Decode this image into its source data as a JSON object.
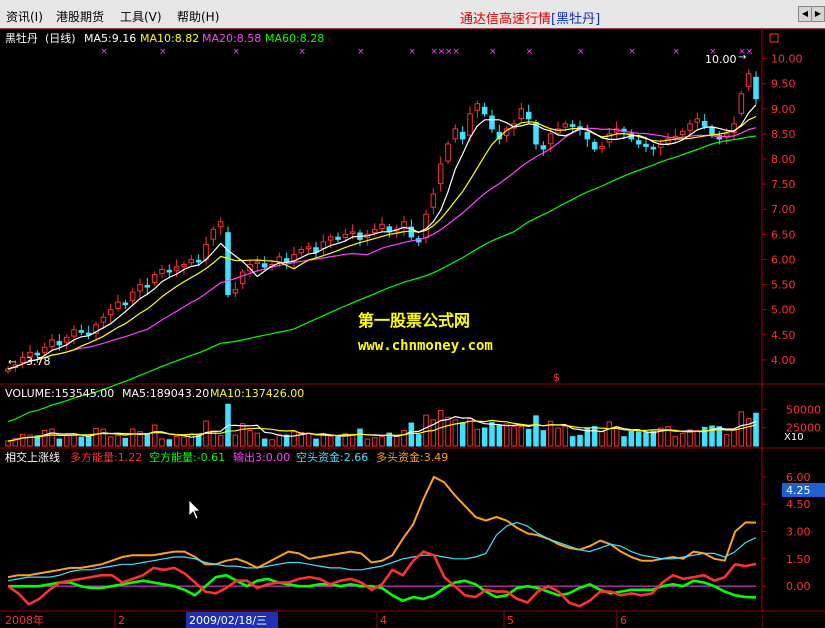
{
  "menubar": {
    "items": [
      "资讯(I)",
      "港股期货",
      "工具(V)",
      "帮助(H)"
    ],
    "title_main": "通达信高速行情",
    "title_stock": "[黑牡丹]"
  },
  "chart_data": [
    {
      "type": "candlestick",
      "panel": "price",
      "stock": "黑牡丹",
      "period": "(日线)",
      "ma_labels": [
        {
          "text": "MA5:9.16",
          "color": "#ffffff"
        },
        {
          "text": "MA10:8.82",
          "color": "#ffff00"
        },
        {
          "text": "MA20:8.58",
          "color": "#ff40ff"
        },
        {
          "text": "MA60:8.28",
          "color": "#00ff00"
        }
      ],
      "ylim": [
        3.6,
        10.25
      ],
      "yticks": [
        "10.00",
        "9.50",
        "9.00",
        "8.50",
        "8.00",
        "7.50",
        "7.00",
        "6.50",
        "6.00",
        "5.50",
        "5.00",
        "4.50",
        "4.00"
      ],
      "annotations": {
        "low_label": "3.78",
        "high_label": "10.00",
        "symbol": "$"
      },
      "close": [
        3.82,
        3.9,
        4.05,
        4.15,
        4.1,
        4.25,
        4.4,
        4.3,
        4.45,
        4.6,
        4.55,
        4.5,
        4.7,
        4.85,
        5.0,
        5.15,
        5.1,
        5.35,
        5.5,
        5.45,
        5.7,
        5.8,
        5.75,
        5.85,
        5.9,
        6.0,
        5.95,
        6.3,
        6.6,
        6.75,
        5.3,
        5.4,
        5.75,
        5.9,
        5.95,
        5.85,
        5.9,
        6.05,
        5.95,
        6.1,
        6.2,
        6.25,
        6.15,
        6.35,
        6.45,
        6.4,
        6.5,
        6.55,
        6.4,
        6.5,
        6.6,
        6.7,
        6.55,
        6.6,
        6.75,
        6.45,
        6.35,
        6.9,
        7.3,
        7.9,
        8.3,
        8.6,
        8.4,
        8.9,
        9.1,
        8.9,
        8.6,
        8.4,
        8.6,
        8.7,
        9.0,
        8.8,
        8.3,
        8.2,
        8.5,
        8.6,
        8.7,
        8.65,
        8.6,
        8.4,
        8.2,
        8.25,
        8.5,
        8.6,
        8.55,
        8.4,
        8.3,
        8.25,
        8.2,
        8.3,
        8.4,
        8.45,
        8.55,
        8.7,
        8.8,
        8.65,
        8.5,
        8.4,
        8.5,
        8.7,
        9.3,
        9.7,
        9.2
      ],
      "volume_labels": [
        {
          "text": "VOLUME:153545.00",
          "color": "#ffffff"
        },
        {
          "text": "MA5:189043.20",
          "color": "#ffffff"
        },
        {
          "text": "MA10:137426.00",
          "color": "#ffff00"
        }
      ],
      "volume_yticks": [
        "50000",
        "25000"
      ],
      "volume_unit": "X10"
    },
    {
      "type": "line",
      "panel": "indicator",
      "name": "相交上涨线",
      "legend": [
        {
          "text": "多方能量:1.22",
          "color": "#ff3030"
        },
        {
          "text": "空方能量:-0.61",
          "color": "#00ff00"
        },
        {
          "text": "输出3:0.00",
          "color": "#ff40ff"
        },
        {
          "text": "空头资金:2.66",
          "color": "#40e0ff"
        },
        {
          "text": "多头资金:3.49",
          "color": "#ffa020"
        }
      ],
      "ylim": [
        -1.2,
        6.6
      ],
      "yticks": [
        "6.00",
        "4.50",
        "3.00",
        "1.50",
        "0.00"
      ],
      "current_value": "4.25",
      "series": [
        {
          "name": "多方能量",
          "color": "#ff3030",
          "values": [
            0.0,
            -0.4,
            -1.0,
            -0.7,
            -0.2,
            0.2,
            0.3,
            0.4,
            0.5,
            0.6,
            0.6,
            0.2,
            0.4,
            0.6,
            1.0,
            0.9,
            1.0,
            0.7,
            0.2,
            -0.3,
            -0.4,
            -0.1,
            0.3,
            0.3,
            -0.1,
            0.1,
            0.2,
            0.2,
            0.4,
            0.5,
            0.4,
            0.1,
            0.3,
            0.4,
            0.2,
            -0.2,
            0.1,
            0.9,
            0.6,
            1.4,
            1.9,
            1.7,
            0.5,
            0.0,
            -0.5,
            -0.6,
            -0.2,
            -0.3,
            -0.3,
            -0.7,
            -0.9,
            -0.3,
            0.0,
            -0.3,
            -0.9,
            -1.1,
            -0.8,
            -0.3,
            -0.3,
            -0.5,
            -0.4,
            -0.5,
            -0.4,
            0.2,
            0.6,
            0.4,
            0.5,
            0.6,
            0.3,
            0.5,
            1.2,
            1.1,
            1.22
          ]
        },
        {
          "name": "空方能量",
          "color": "#00ff00",
          "values": [
            0.0,
            0.0,
            0.0,
            0.0,
            0.1,
            0.2,
            0.2,
            0.0,
            -0.1,
            -0.1,
            0.0,
            0.1,
            0.2,
            0.3,
            0.2,
            0.1,
            0.0,
            -0.2,
            -0.5,
            0.0,
            0.5,
            0.6,
            0.3,
            0.0,
            0.3,
            0.4,
            0.2,
            0.1,
            0.0,
            0.0,
            0.1,
            0.1,
            0.0,
            0.1,
            0.0,
            0.0,
            -0.1,
            -0.5,
            -0.8,
            -0.6,
            -0.7,
            -0.5,
            -0.1,
            0.2,
            0.3,
            0.1,
            -0.3,
            -0.6,
            -0.5,
            -0.1,
            0.0,
            -0.1,
            -0.3,
            -0.5,
            -0.4,
            -0.1,
            0.1,
            -0.2,
            -0.4,
            -0.3,
            -0.2,
            -0.2,
            -0.2,
            0.0,
            0.1,
            0.0,
            0.3,
            0.2,
            0.0,
            -0.3,
            -0.5,
            -0.6,
            -0.61
          ]
        },
        {
          "name": "空头资金",
          "color": "#40e0ff",
          "values": [
            0.3,
            0.4,
            0.5,
            0.5,
            0.5,
            0.6,
            0.8,
            0.9,
            0.9,
            1.0,
            1.1,
            1.2,
            1.2,
            1.3,
            1.4,
            1.5,
            1.6,
            1.6,
            1.5,
            1.3,
            1.2,
            1.1,
            1.1,
            1.0,
            1.0,
            1.1,
            1.2,
            1.3,
            1.3,
            1.2,
            1.1,
            1.0,
            1.0,
            0.9,
            0.9,
            1.0,
            1.1,
            1.3,
            1.5,
            1.6,
            1.7,
            1.7,
            1.6,
            1.5,
            1.5,
            1.6,
            1.8,
            2.8,
            3.3,
            3.5,
            3.3,
            2.9,
            2.6,
            2.4,
            2.2,
            2.0,
            1.9,
            2.1,
            2.3,
            2.2,
            1.9,
            1.7,
            1.6,
            1.5,
            1.5,
            1.6,
            1.7,
            1.8,
            1.8,
            1.6,
            1.9,
            2.4,
            2.66
          ]
        },
        {
          "name": "多头资金",
          "color": "#ffa020",
          "values": [
            0.5,
            0.6,
            0.6,
            0.7,
            0.8,
            0.9,
            1.0,
            1.0,
            1.1,
            1.2,
            1.4,
            1.6,
            1.7,
            1.7,
            1.7,
            1.8,
            1.9,
            1.9,
            1.6,
            1.2,
            1.2,
            1.4,
            1.5,
            1.3,
            1.0,
            1.3,
            1.6,
            1.9,
            1.8,
            1.5,
            1.6,
            1.7,
            1.8,
            1.9,
            1.8,
            1.3,
            1.4,
            1.7,
            2.6,
            3.4,
            4.8,
            6.0,
            5.7,
            5.0,
            4.4,
            3.8,
            3.6,
            3.8,
            3.6,
            3.2,
            2.9,
            2.8,
            2.6,
            2.3,
            2.1,
            2.0,
            2.2,
            2.5,
            2.3,
            1.9,
            1.6,
            1.4,
            1.4,
            1.5,
            1.6,
            1.5,
            1.9,
            1.8,
            1.5,
            1.4,
            3.0,
            3.5,
            3.49
          ]
        },
        {
          "name": "输出3",
          "color": "#ff40ff",
          "values": [
            0.0,
            0.0
          ]
        }
      ]
    }
  ],
  "date_bar": {
    "labels": [
      "2008年",
      "2",
      "2009/02/18/三",
      "4",
      "5",
      "6"
    ]
  }
}
